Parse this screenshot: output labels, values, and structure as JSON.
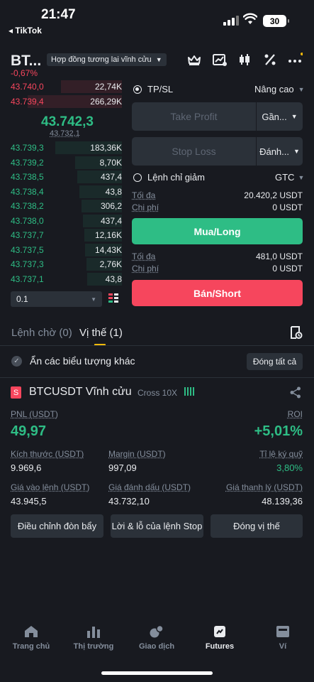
{
  "status_bar": {
    "time": "21:47",
    "back_app": "◂ TikTok",
    "battery": "30"
  },
  "header": {
    "symbol": "BT...",
    "change": "-0,67%",
    "contract_type": "Hợp đồng tương lai vĩnh cửu"
  },
  "order_book": {
    "asks": [
      {
        "price": "43.740,0",
        "qty": "22,74K",
        "depth": 0.55
      },
      {
        "price": "43.739,4",
        "qty": "266,29K",
        "depth": 0.85
      }
    ],
    "last_price": "43.742,3",
    "mark_price": "43.732,1",
    "bids": [
      {
        "price": "43.739,3",
        "qty": "183,36K",
        "depth": 0.6
      },
      {
        "price": "43.739,2",
        "qty": "8,70K",
        "depth": 0.42
      },
      {
        "price": "43.738,5",
        "qty": "437,4",
        "depth": 0.4
      },
      {
        "price": "43.738,4",
        "qty": "43,8",
        "depth": 0.38
      },
      {
        "price": "43.738,2",
        "qty": "306,2",
        "depth": 0.36
      },
      {
        "price": "43.738,0",
        "qty": "437,4",
        "depth": 0.35
      },
      {
        "price": "43.737,7",
        "qty": "12,16K",
        "depth": 0.34
      },
      {
        "price": "43.737,5",
        "qty": "14,43K",
        "depth": 0.33
      },
      {
        "price": "43.737,3",
        "qty": "2,76K",
        "depth": 0.32
      },
      {
        "price": "43.737,1",
        "qty": "43,8",
        "depth": 0.31
      }
    ],
    "step": "0.1"
  },
  "order_form": {
    "tpsl_label": "TP/SL",
    "advanced": "Nâng cao",
    "take_profit_placeholder": "Take Profit",
    "take_profit_select": "Gần...",
    "stop_loss_placeholder": "Stop Loss",
    "stop_loss_select": "Đánh...",
    "reduce_only": "Lệnh chỉ giảm",
    "tif": "GTC",
    "buy": {
      "max_label": "Tối đa",
      "max_value": "20.420,2 USDT",
      "cost_label": "Chi phí",
      "cost_value": "0 USDT",
      "button": "Mua/Long"
    },
    "sell": {
      "max_label": "Tối đa",
      "max_value": "481,0 USDT",
      "cost_label": "Chi phí",
      "cost_value": "0 USDT",
      "button": "Bán/Short"
    }
  },
  "tabs": {
    "open_orders": "Lệnh chờ (0)",
    "positions": "Vị thế (1)"
  },
  "hide_other": "Ẩn các biểu tượng khác",
  "close_all": "Đóng tất cả",
  "position": {
    "badge": "S",
    "symbol": "BTCUSDT Vĩnh cửu",
    "mode": "Cross 10X",
    "pnl_label": "PNL (USDT)",
    "pnl": "49,97",
    "roi_label": "ROI",
    "roi": "+5,01%",
    "size_label": "Kích thước (USDT)",
    "size": "9.969,6",
    "margin_label": "Margin (USDT)",
    "margin": "997,09",
    "margin_ratio_label": "Tỉ lệ ký quỹ",
    "margin_ratio": "3,80%",
    "entry_label": "Giá vào lệnh (USDT)",
    "entry": "43.945,5",
    "mark_label": "Giá đánh dấu (USDT)",
    "mark": "43.732,10",
    "liq_label": "Giá thanh lý (USDT)",
    "liq": "48.139,36",
    "btn_leverage": "Điều chỉnh đòn bẩy",
    "btn_tpsl": "Lời & lỗ của lệnh Stop",
    "btn_close": "Đóng vị thế"
  },
  "nav": [
    "Trang chủ",
    "Thị trường",
    "Giao dịch",
    "Futures",
    "Ví"
  ],
  "colors": {
    "bg": "#181a20",
    "green": "#2ebd85",
    "red": "#f6465d",
    "yellow": "#f0b90b",
    "panel": "#2b3139"
  }
}
